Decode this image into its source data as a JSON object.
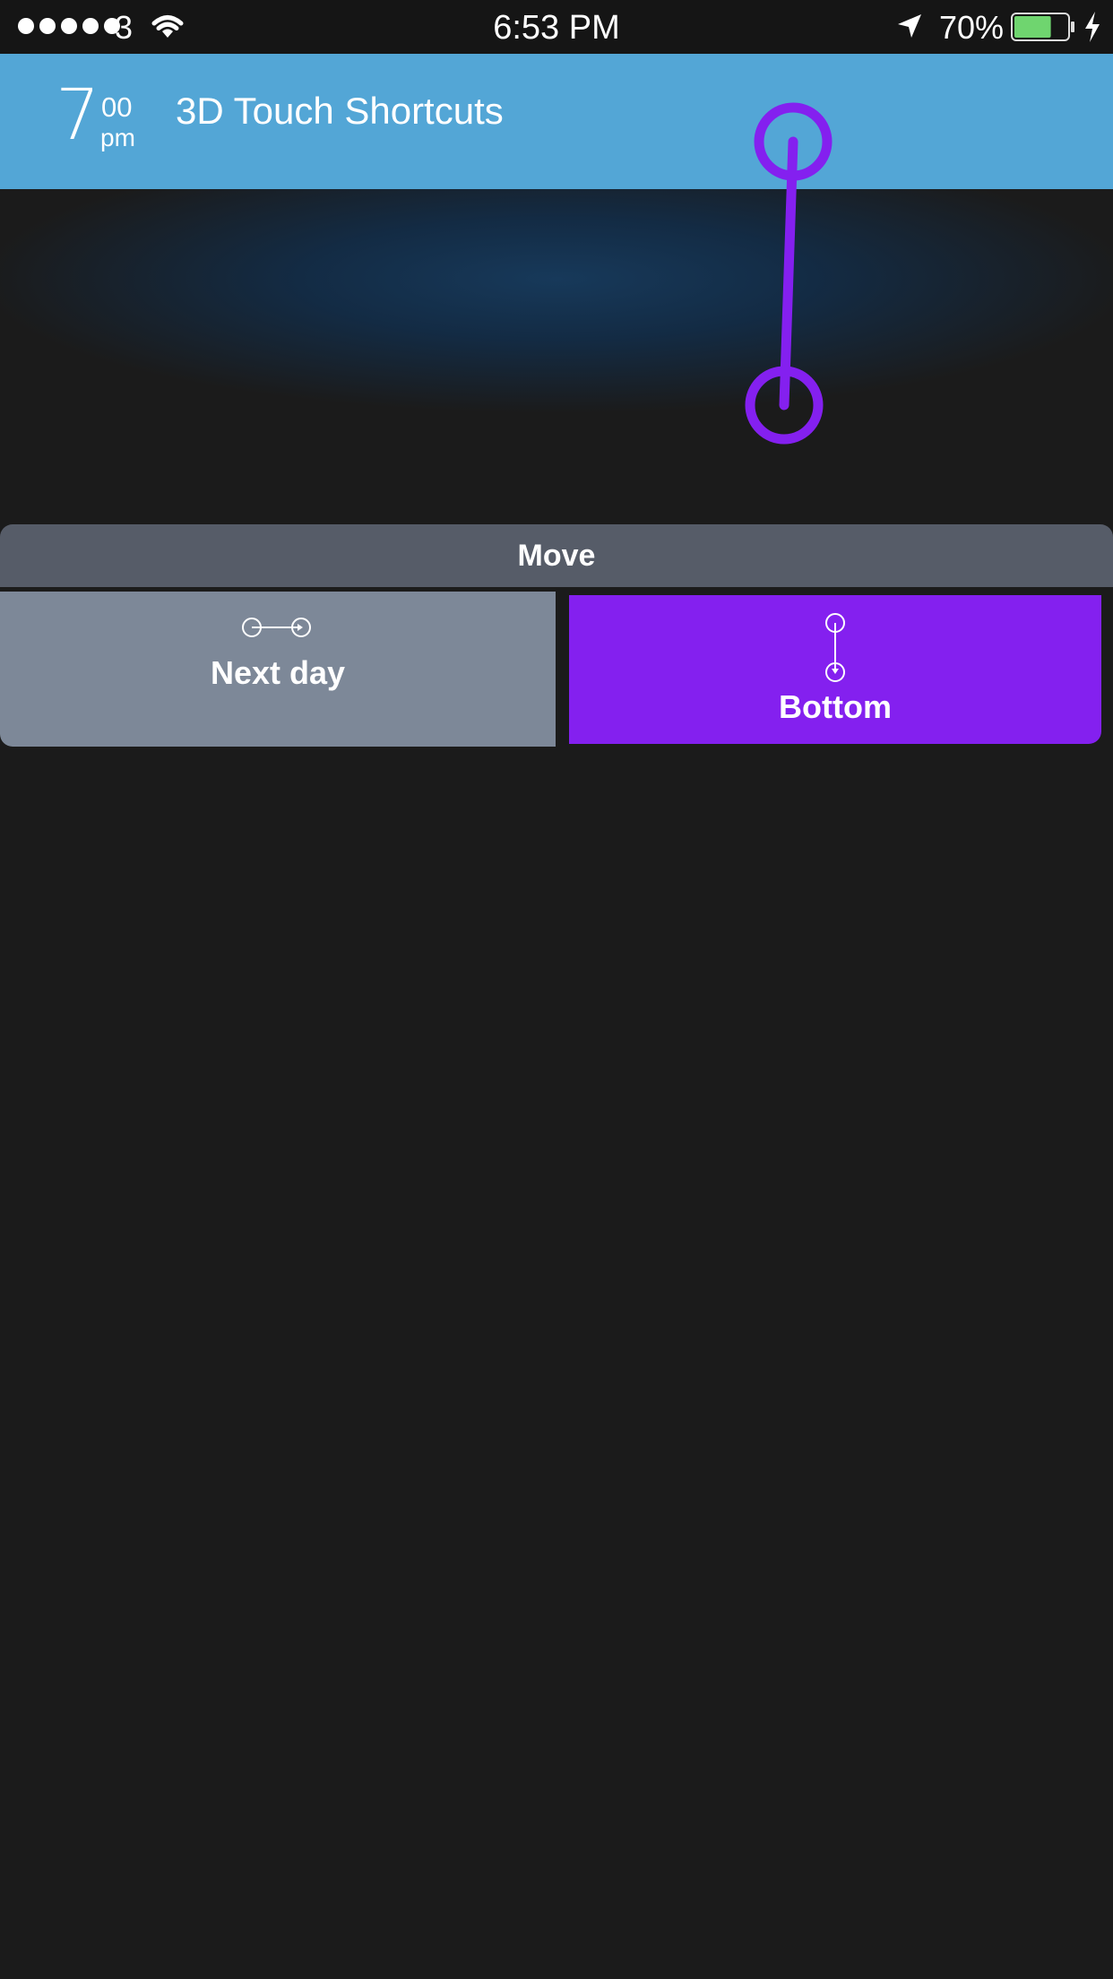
{
  "status_bar": {
    "carrier": "3",
    "time": "6:53 PM",
    "battery_percent": "70%",
    "battery_level": 0.7,
    "signal_icon": "signal-dots-icon",
    "wifi_icon": "wifi-icon",
    "location_icon": "location-arrow-icon",
    "charging_icon": "bolt-icon"
  },
  "header": {
    "hour": "7",
    "minutes": "00",
    "ampm": "pm",
    "title": "3D Touch Shortcuts",
    "background_color": "#53a6d6"
  },
  "gesture": {
    "icon": "drag-gesture-icon",
    "color": "#8420ef"
  },
  "action_sheet": {
    "title": "Move",
    "options": [
      {
        "label": "Next day",
        "icon": "arrow-right-circle-icon",
        "color": "#7d8898",
        "selected": false
      },
      {
        "label": "Bottom",
        "icon": "arrow-down-circle-icon",
        "color": "#8420ef",
        "selected": true
      }
    ]
  }
}
